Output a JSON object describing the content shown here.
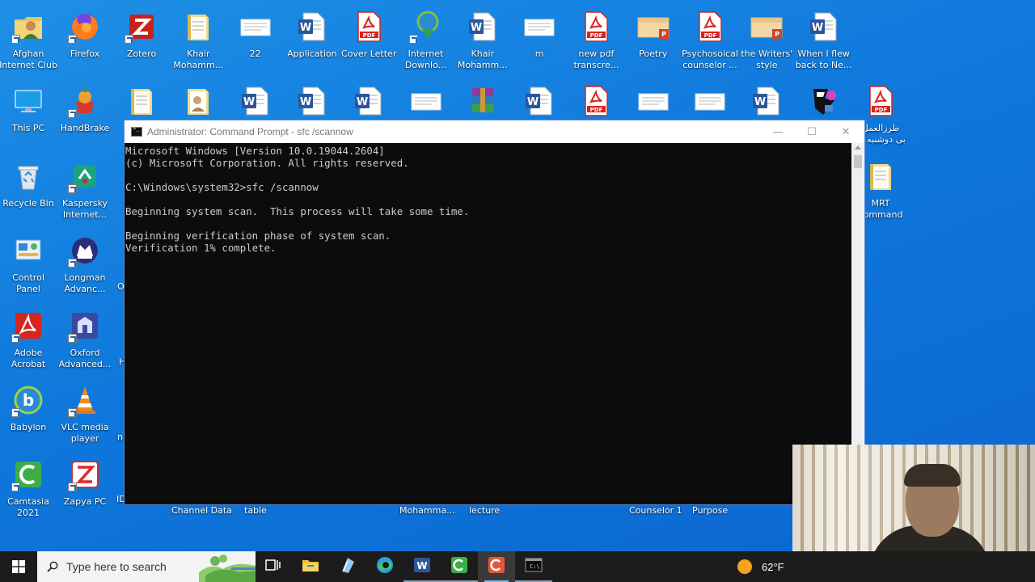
{
  "desktop": {
    "col1": [
      {
        "name": "Afghan Internet Club",
        "l1": "Afghan",
        "l2": "Internet Club",
        "icon": "folder-person-icon"
      },
      {
        "name": "This PC",
        "l1": "This PC",
        "l2": "",
        "icon": "monitor-icon"
      },
      {
        "name": "Recycle Bin",
        "l1": "Recycle Bin",
        "l2": "",
        "icon": "recycle-bin-icon"
      },
      {
        "name": "Control Panel",
        "l1": "Control",
        "l2": "Panel",
        "icon": "control-panel-icon"
      },
      {
        "name": "Adobe Acrobat",
        "l1": "Adobe",
        "l2": "Acrobat",
        "icon": "acrobat-icon"
      },
      {
        "name": "Babylon",
        "l1": "Babylon",
        "l2": "",
        "icon": "babylon-icon"
      },
      {
        "name": "Camtasia 2021",
        "l1": "Camtasia",
        "l2": "2021",
        "icon": "camtasia-icon"
      }
    ],
    "col2": [
      {
        "name": "Firefox",
        "l1": "Firefox",
        "l2": "",
        "icon": "firefox-icon"
      },
      {
        "name": "HandBrake",
        "l1": "HandBrake",
        "l2": "",
        "icon": "handbrake-icon"
      },
      {
        "name": "Kaspersky Internet",
        "l1": "Kaspersky",
        "l2": "Internet...",
        "icon": "kaspersky-icon"
      },
      {
        "name": "Longman Advanc",
        "l1": "Longman",
        "l2": "Advanc...",
        "icon": "longman-icon"
      },
      {
        "name": "Oxford Advanced",
        "l1": "Oxford",
        "l2": "Advanced...",
        "icon": "oxford-icon"
      },
      {
        "name": "VLC media player",
        "l1": "VLC media",
        "l2": "player",
        "icon": "vlc-icon"
      },
      {
        "name": "Zapya PC",
        "l1": "Zapya PC",
        "l2": "",
        "icon": "zapya-icon"
      }
    ],
    "row1": [
      {
        "name": "Zotero",
        "l1": "Zotero",
        "l2": "",
        "icon": "zotero-icon"
      },
      {
        "name": "Khair Mohamm 1",
        "l1": "Khair",
        "l2": "Mohamm...",
        "icon": "folder-doc-icon"
      },
      {
        "name": "22",
        "l1": "22",
        "l2": "",
        "icon": "document-thumb-icon"
      },
      {
        "name": "Application",
        "l1": "Application",
        "l2": "",
        "icon": "word-doc-icon"
      },
      {
        "name": "Cover Letter",
        "l1": "Cover Letter",
        "l2": "",
        "icon": "pdf-icon"
      },
      {
        "name": "Internet Downlo",
        "l1": "Internet",
        "l2": "Downlo...",
        "icon": "idm-icon"
      },
      {
        "name": "Khair Mohamm 2",
        "l1": "Khair",
        "l2": "Mohamm...",
        "icon": "word-doc-icon"
      },
      {
        "name": "m",
        "l1": "m",
        "l2": "",
        "icon": "document-thumb-icon"
      },
      {
        "name": "new pdf transcre",
        "l1": "new pdf",
        "l2": "transcre...",
        "icon": "pdf-icon"
      },
      {
        "name": "Poetry",
        "l1": "Poetry",
        "l2": "",
        "icon": "ppt-folder-icon"
      },
      {
        "name": "Psychosoical counselor",
        "l1": "Psychosoical",
        "l2": "counselor ...",
        "icon": "pdf-icon"
      },
      {
        "name": "the Writers style",
        "l1": "the Writers'",
        "l2": "style",
        "icon": "ppt-folder-icon"
      },
      {
        "name": "When I flew back to Ne",
        "l1": "When I flew",
        "l2": "back to Ne...",
        "icon": "word-doc-icon"
      }
    ],
    "row2_icons": [
      "folder-doc-icon",
      "folder-image-icon",
      "word-doc-icon",
      "word-doc-icon",
      "word-doc-icon",
      "document-thumb-icon",
      "winrar-icon",
      "word-doc-icon",
      "pdf-icon",
      "document-thumb-icon",
      "document-thumb-icon",
      "word-doc-icon",
      "mascot-icon"
    ],
    "right_icons": [
      {
        "name": "arabic pdf",
        "l1": "طرزالعمل",
        "l2": "... بی دوشنبه",
        "icon": "pdf-icon"
      },
      {
        "name": "MRT command",
        "l1": "MRT",
        "l2": "command",
        "icon": "folder-doc-icon"
      }
    ],
    "bottom_labels": [
      "Channel Data",
      "table",
      "Mohamma...",
      "lecture",
      "Counselor 1",
      "Purpose"
    ],
    "partial_labels": [
      "O",
      "H",
      "n",
      "ID"
    ]
  },
  "cmd": {
    "title": "Administrator: Command Prompt - sfc  /scannow",
    "minimize": "—",
    "maximize": "☐",
    "close": "✕",
    "lines": [
      "Microsoft Windows [Version 10.0.19044.2604]",
      "(c) Microsoft Corporation. All rights reserved.",
      "",
      "C:\\Windows\\system32>sfc /scannow",
      "",
      "Beginning system scan.  This process will take some time.",
      "",
      "Beginning verification phase of system scan.",
      "Verification 1% complete."
    ]
  },
  "taskbar": {
    "search_placeholder": "Type here to search",
    "apps": [
      "task-view-icon",
      "file-explorer-icon",
      "notepad-icon",
      "edge-icon",
      "word-icon",
      "camtasia-icon",
      "camtasia-recorder-icon",
      "cmd-icon"
    ],
    "weather": {
      "temp": "62°F"
    }
  },
  "colors": {
    "desktop_blue": "#0f78dc",
    "console_bg": "#0c0c0c",
    "console_text": "#cccccc",
    "taskbar": "#1c1c1c"
  }
}
